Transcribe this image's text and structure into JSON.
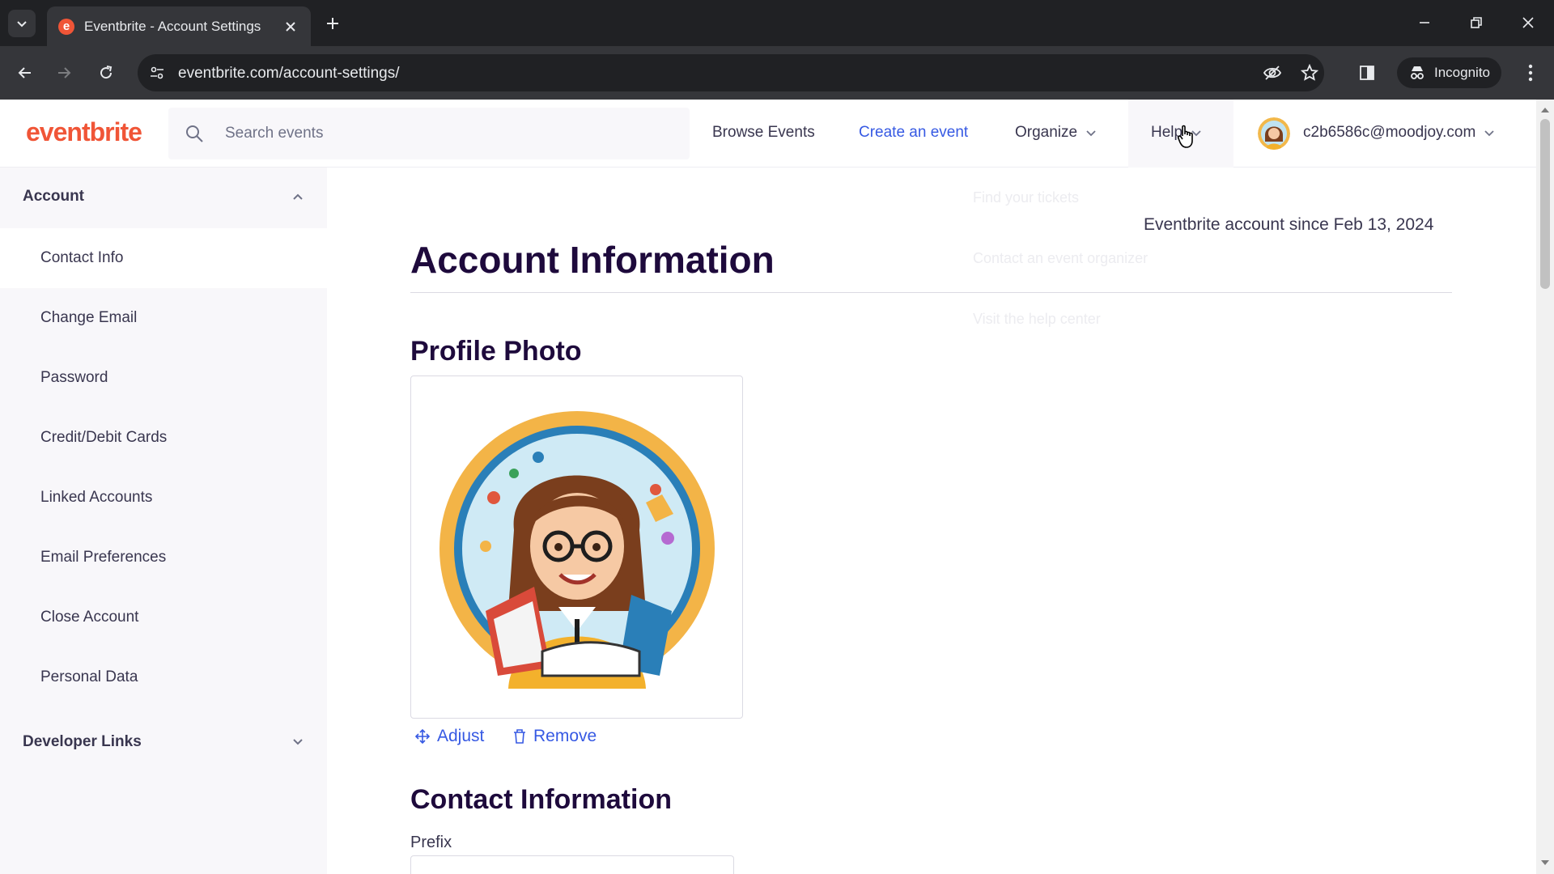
{
  "browser": {
    "tab_title": "Eventbrite - Account Settings",
    "favicon_letter": "e",
    "url": "eventbrite.com/account-settings/",
    "incognito_label": "Incognito"
  },
  "header": {
    "logo": "eventbrite",
    "search_placeholder": "Search events",
    "nav": {
      "browse": "Browse Events",
      "create": "Create an event",
      "organize": "Organize",
      "help": "Help"
    },
    "user_email": "c2b6586c@moodjoy.com"
  },
  "sidebar": {
    "account_section": "Account",
    "items": [
      {
        "label": "Contact Info"
      },
      {
        "label": "Change Email"
      },
      {
        "label": "Password"
      },
      {
        "label": "Credit/Debit Cards"
      },
      {
        "label": "Linked Accounts"
      },
      {
        "label": "Email Preferences"
      },
      {
        "label": "Close Account"
      },
      {
        "label": "Personal Data"
      }
    ],
    "developer_section": "Developer Links"
  },
  "help_dropdown": {
    "items": [
      "Find your tickets",
      "Contact an event organizer",
      "Visit the help center"
    ]
  },
  "main": {
    "account_since": "Eventbrite account since Feb 13, 2024",
    "title": "Account Information",
    "profile_photo_heading": "Profile Photo",
    "adjust_label": "Adjust",
    "remove_label": "Remove",
    "contact_heading": "Contact Information",
    "prefix_label": "Prefix"
  },
  "colors": {
    "brand_orange": "#f05537",
    "link_blue": "#3659e3",
    "heading_dark": "#1e0a3c"
  }
}
